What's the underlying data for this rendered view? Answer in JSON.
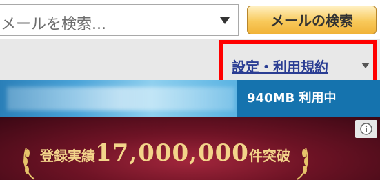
{
  "search": {
    "placeholder": "メールを検索...",
    "button_label": "メールの検索"
  },
  "settings": {
    "link_label": "設定・利用規約"
  },
  "status": {
    "storage": "940MB 利用中"
  },
  "ad": {
    "prefix": "登録実績",
    "number": "17,000,000",
    "suffix": "件突破"
  },
  "colors": {
    "accent_blue": "#1573ae",
    "link_blue": "#2a3d93",
    "highlight_red": "#ff0000",
    "button_gold": "#f8c95a"
  },
  "icons": {
    "search_dropdown": "chevron-down-icon",
    "settings_dropdown": "caret-down-icon",
    "ad_info": "info-icon"
  }
}
